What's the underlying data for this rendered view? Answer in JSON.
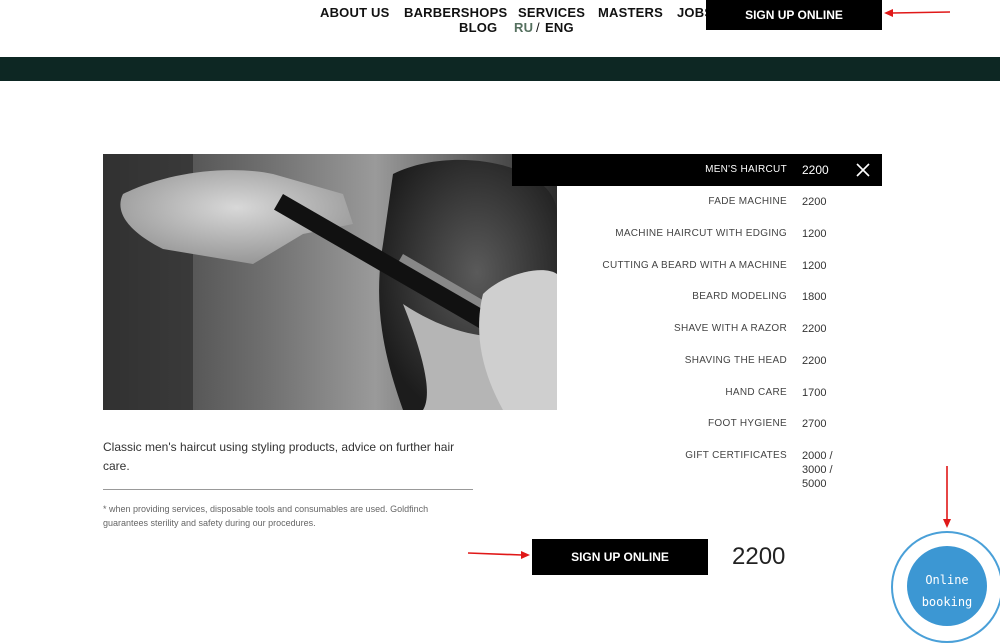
{
  "nav": {
    "about": "ABOUT US",
    "barbershops": "BARBERSHOPS",
    "services": "SERVICES",
    "masters": "MASTERS",
    "jobs": "JOBS",
    "blog": "BLOG",
    "lang_ru": "RU",
    "lang_sep": "/",
    "lang_eng": "ENG",
    "signup": "SIGN UP ONLINE"
  },
  "service": {
    "description": "Classic men's haircut using styling products, advice on further hair care.",
    "note": "* when providing services, disposable tools and consumables are used. Goldfinch guarantees sterility and safety during our procedures."
  },
  "price_list": [
    {
      "name": "MEN'S HAIRCUT",
      "price": "2200",
      "active": true
    },
    {
      "name": "FADE MACHINE",
      "price": "2200"
    },
    {
      "name": "MACHINE HAIRCUT WITH EDGING",
      "price": "1200"
    },
    {
      "name": "CUTTING A BEARD WITH A MACHINE",
      "price": "1200"
    },
    {
      "name": "BEARD MODELING",
      "price": "1800"
    },
    {
      "name": "SHAVE WITH A RAZOR",
      "price": "2200"
    },
    {
      "name": "SHAVING THE HEAD",
      "price": "2200"
    },
    {
      "name": "HAND CARE",
      "price": "1700"
    },
    {
      "name": "FOOT HYGIENE",
      "price": "2700"
    },
    {
      "name": "GIFT CERTIFICATES",
      "price_lines": [
        "2000 /",
        "3000 /",
        "5000"
      ]
    }
  ],
  "footer": {
    "signup": "SIGN UP ONLINE",
    "price": "2200"
  },
  "booking": {
    "line1": "Online",
    "line2": "booking"
  },
  "colors": {
    "band": "#0d2723",
    "booking": "#3c97d3",
    "arrow": "#e01818"
  }
}
